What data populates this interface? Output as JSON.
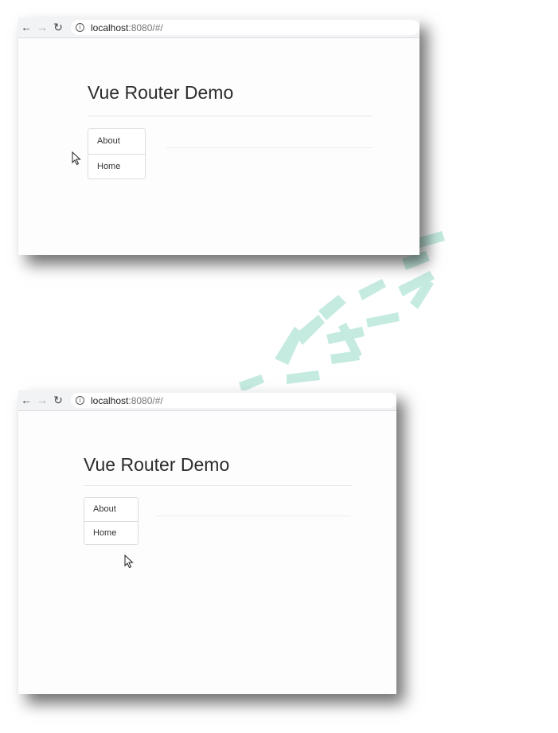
{
  "screens": [
    {
      "url_host": "localhost",
      "url_rest": ":8080/#/",
      "title": "Vue Router Demo",
      "nav": [
        {
          "label": "About"
        },
        {
          "label": "Home"
        }
      ]
    },
    {
      "url_host": "localhost",
      "url_rest": ":8080/#/",
      "title": "Vue Router Demo",
      "nav": [
        {
          "label": "About"
        },
        {
          "label": "Home"
        }
      ]
    }
  ],
  "icons": {
    "back": "back-arrow-icon",
    "forward": "forward-arrow-icon",
    "reload": "reload-icon",
    "info": "info-icon",
    "cursor": "mouse-cursor-icon"
  },
  "colors": {
    "toolbar": "#f1f3f4",
    "page_background": "#fdfdfd",
    "watermark": "#b2e5d8"
  }
}
